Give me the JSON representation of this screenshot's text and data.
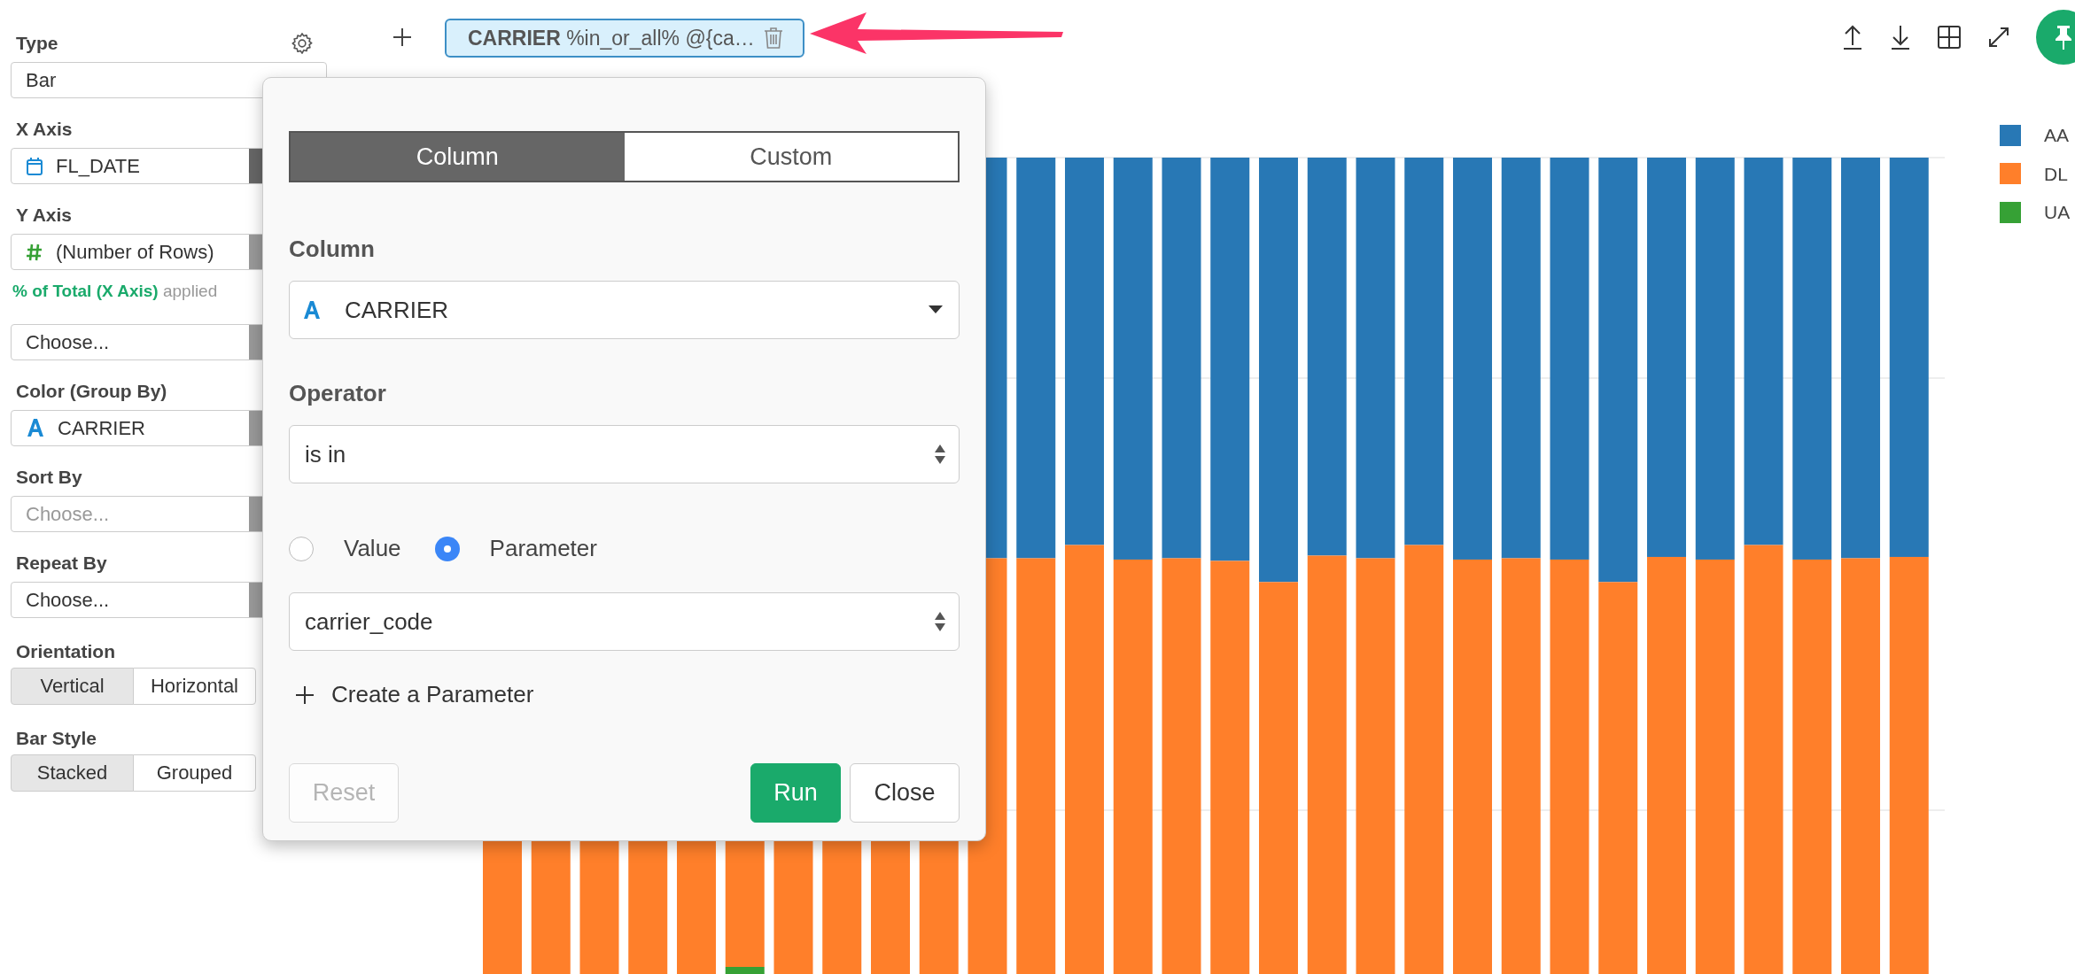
{
  "sidebar": {
    "sections": [
      {
        "label": "Type",
        "value": "Bar",
        "kind": "plain"
      },
      {
        "label": "X Axis",
        "value": "FL_DATE",
        "kind": "date"
      },
      {
        "label": "Y Axis",
        "value": "(Number of Rows)",
        "kind": "number",
        "note": "**% of Total (X Axis)** applied"
      },
      {
        "value": "Choose...",
        "kind": "plain"
      },
      {
        "label": "Color (Group By)",
        "value": "CARRIER",
        "kind": "text"
      },
      {
        "label": "Sort By",
        "placeholder": "Choose...",
        "kind": "plain"
      },
      {
        "label": "Repeat By",
        "value": "Choose...",
        "kind": "plain"
      }
    ],
    "toggles": [
      {
        "label": "Orientation",
        "options": [
          {
            "label": "Vertical",
            "selected": true
          },
          {
            "label": "Horizontal",
            "selected": false
          }
        ]
      },
      {
        "label": "Bar Style",
        "options": [
          {
            "label": "Stacked",
            "selected": true
          },
          {
            "label": "Grouped",
            "selected": false
          }
        ]
      }
    ]
  },
  "filter_chip": {
    "column": "CARRIER",
    "expression": "%in_or_all% @{ca…"
  },
  "popover": {
    "tabs": [
      {
        "label": "Column",
        "selected": true
      },
      {
        "label": "Custom",
        "selected": false
      }
    ],
    "column": {
      "label": "Column",
      "value": "CARRIER"
    },
    "operator": {
      "label": "Operator",
      "value": "is in"
    },
    "source_options": [
      {
        "label": "Value",
        "selected": false
      },
      {
        "label": "Parameter",
        "selected": true
      }
    ],
    "parameter": {
      "value": "carrier_code"
    },
    "create_link": "Create a Parameter",
    "buttons": [
      {
        "label": "Reset",
        "kind": "default",
        "disabled": true
      },
      {
        "label": "Run",
        "kind": "primary",
        "disabled": false
      },
      {
        "label": "Close",
        "kind": "default",
        "disabled": false
      }
    ]
  },
  "legend": [
    {
      "label": "AA",
      "color": "#2878b5"
    },
    {
      "label": "DL",
      "color": "#ff7f2a"
    },
    {
      "label": "UA",
      "color": "#36a135"
    }
  ]
}
